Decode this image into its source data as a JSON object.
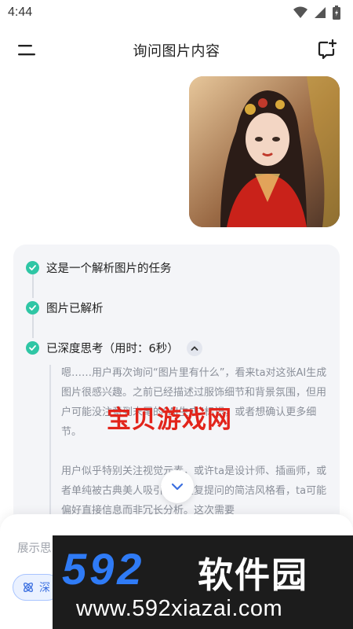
{
  "status_bar": {
    "time": "4:44",
    "icons": [
      "wifi-icon",
      "signal-icon",
      "battery-icon"
    ]
  },
  "header": {
    "title": "询问图片内容",
    "left_icon": "menu-icon",
    "right_icon": "new-chat-icon"
  },
  "message": {
    "image_alt": "user-uploaded-illustration"
  },
  "answer": {
    "steps": [
      {
        "label": "这是一个解析图片的任务",
        "status": "done"
      },
      {
        "label": "图片已解析",
        "status": "done"
      },
      {
        "label": "已深度思考（用时：6秒）",
        "status": "done"
      }
    ],
    "thinking_paragraphs": [
      "嗯……用户再次询问“图片里有什么”，看来ta对这张AI生成图片很感兴趣。之前已经描述过服饰细节和背景氛围，但用户可能没注意到末尾的“AI生成”标识，或者想确认更多细节。",
      "用户似乎特别关注视觉元素，或许ta是设计师、插画师，或者单纯被古典美人吸引。从重复提问的简洁风格看，ta可能偏好直接信息而非冗长分析。这次需要"
    ]
  },
  "input": {
    "placeholder": "展示思",
    "deep_think_label": "深"
  },
  "watermark": {
    "text": "宝贝游戏网"
  },
  "site_banner": {
    "logo": "592",
    "name": "软件园",
    "url": "www.592xiazai.com"
  },
  "colors": {
    "accent_green": "#2fc6a5",
    "accent_blue": "#3b6fe0",
    "card_bg": "#f4f5f8"
  }
}
